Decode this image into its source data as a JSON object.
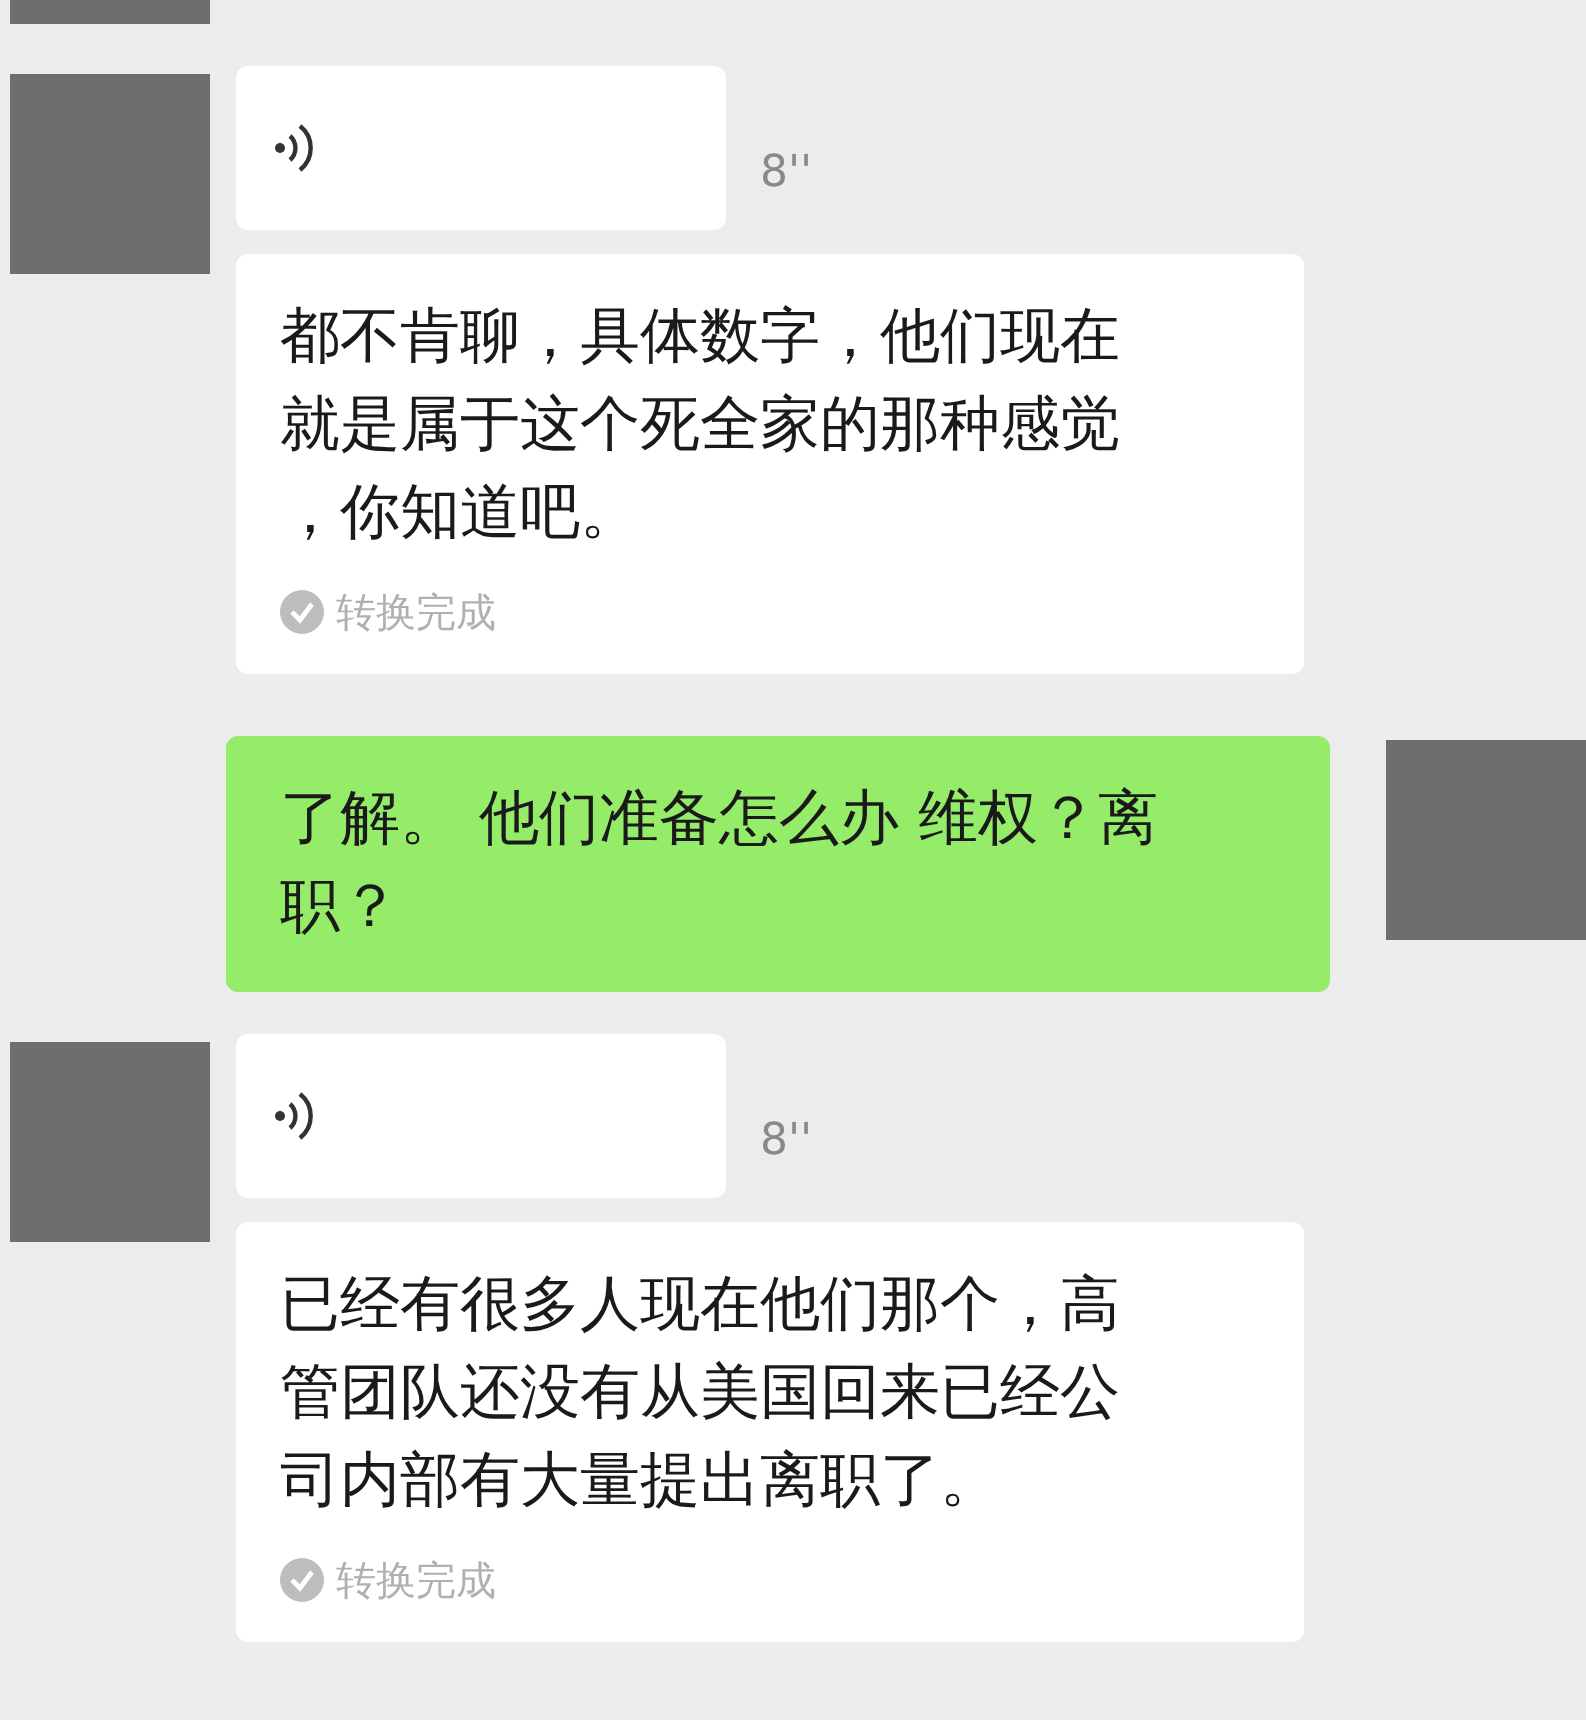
{
  "messages": [
    {
      "kind": "voice",
      "outgoing": false,
      "duration": "8''",
      "transcript": "都不肯聊，具体数字，他们现在就是属于这个死全家的那种感觉，你知道吧。",
      "status": "转换完成"
    },
    {
      "kind": "text",
      "outgoing": true,
      "text": "了解。 他们准备怎么办 维权？离职？"
    },
    {
      "kind": "voice",
      "outgoing": false,
      "duration": "8''",
      "transcript": "已经有很多人现在他们那个，高管团队还没有从美国回来已经公司内部有大量提出离职了。",
      "status": "转换完成"
    }
  ]
}
